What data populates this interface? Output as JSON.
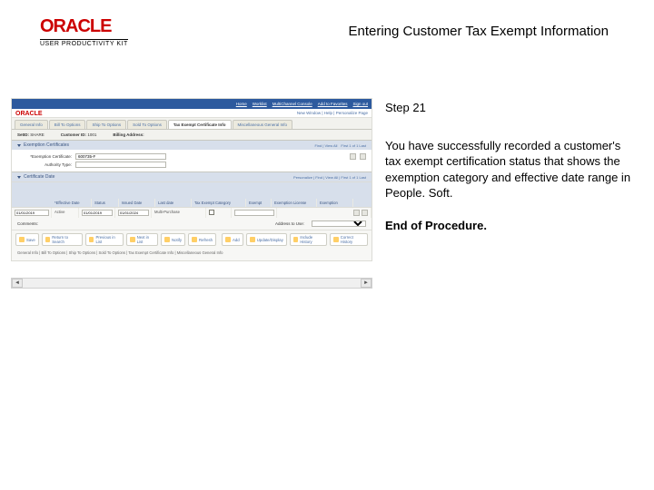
{
  "brand": {
    "name": "ORACLE",
    "product": "USER PRODUCTIVITY KIT"
  },
  "page_title": "Entering Customer Tax Exempt Information",
  "app": {
    "topbar_links": [
      "Home",
      "Worklist",
      "MultiChannel Console",
      "Add to Favorites",
      "Sign out"
    ],
    "top_right": "New Window | Help | Personalize Page",
    "tabs": [
      "General Info",
      "Bill To Options",
      "Ship To Options",
      "Sold To Options",
      "Tax Exempt Certificate Info",
      "Miscellaneous General Info"
    ],
    "active_tab_index": 4,
    "info": {
      "setid_label": "SetID:",
      "setid": "SHARE",
      "cust_label": "Customer ID:",
      "cust": "1001",
      "name_label": "Billing Address:",
      "name": ""
    },
    "panel1": "Exemption Certificates",
    "panel1_right": [
      "",
      "Find | View All",
      "First  1 of 1  Last"
    ],
    "fields": {
      "ex_cert_label": "*Exemption Certificate:",
      "ex_cert_val": "600735-F",
      "auth_label": "Authority Type:",
      "auth_val": "",
      "issued_label": "Issued Date:",
      "tax_class_label": "Last Date:"
    },
    "panel2": "Certificate Date",
    "panel2_right": "Personalize | Find | View All |    First  1 of 1  Last",
    "grid_headers": [
      "*Effective Date",
      "Status",
      "Issued Date",
      "Last date",
      "Tax Exempt Category",
      "Exempt",
      "Exemption License",
      "Exemption"
    ],
    "grid_row": {
      "eff": "01/01/2019",
      "status": "Active",
      "issued": "01/01/2019",
      "last": "01/01/2024",
      "cat": "Multi-Purchase"
    },
    "comments_label": "Comments:",
    "address_label": "Address to Use:",
    "address_val": "",
    "toolbar": [
      "Save",
      "Return to Search",
      "Previous in List",
      "Next in List",
      "Notify",
      "Refresh",
      "Add",
      "Update/Display",
      "Include History",
      "Correct History"
    ],
    "breadcrumb": "General Info | Bill To Options | Ship To Options | Sold To Options | Tax Exempt Certificate Info | Miscellaneous General Info"
  },
  "instructions": {
    "step": "Step 21",
    "body": "You have successfully recorded a customer's tax exempt certification status that shows the exemption category and effective date range in People. Soft.",
    "end": "End of Procedure."
  }
}
